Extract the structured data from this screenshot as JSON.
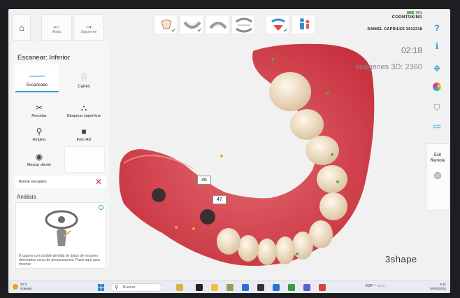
{
  "nav": {
    "back_label": "Atrás",
    "next_label": "Siguiente"
  },
  "panel": {
    "title": "Escanear: Inferior",
    "modes": [
      {
        "label": "Escaneado",
        "selected": true
      },
      {
        "label": "Caries",
        "selected": false
      }
    ],
    "tools": [
      {
        "label": "Recortar",
        "icon": "scissors-icon"
      },
      {
        "label": "Bloquear superficie",
        "icon": "lock-surface-icon"
      },
      {
        "label": "Ampliar",
        "icon": "magnifier-icon"
      },
      {
        "label": "Foto HD",
        "icon": "camera-icon"
      },
      {
        "label": "Marcar diente",
        "icon": "tooth-marker-icon"
      }
    ],
    "delete_label": "Borrar escaneo"
  },
  "analysis": {
    "title": "Análisis",
    "text": "8 lugares con posible pérdida de datos de escaneo detectados cerca de preparaciones. Pulse aquí para mostrar."
  },
  "header": {
    "organization": "COONTOKING",
    "patient": "DANIEL CAPRILES 2912318",
    "battery": "76%",
    "time": "02:18",
    "images_3d": "Imágenes 3D: 2360"
  },
  "viewer": {
    "tooth_labels": [
      "46",
      "47"
    ],
    "brand": "3shape"
  },
  "right_toolbar": {
    "exit_remote": "Exit Remote"
  },
  "taskbar": {
    "weather_temp": "20°C",
    "weather_desc": "Soleado",
    "search_placeholder": "Buscar",
    "language": "ESP",
    "time": "9:32",
    "date": "04/06/2024"
  },
  "colors": {
    "accent": "#2fa3d8",
    "delete": "#d21f2b",
    "gingiva": "#d8434c",
    "check": "#3aa23a"
  }
}
